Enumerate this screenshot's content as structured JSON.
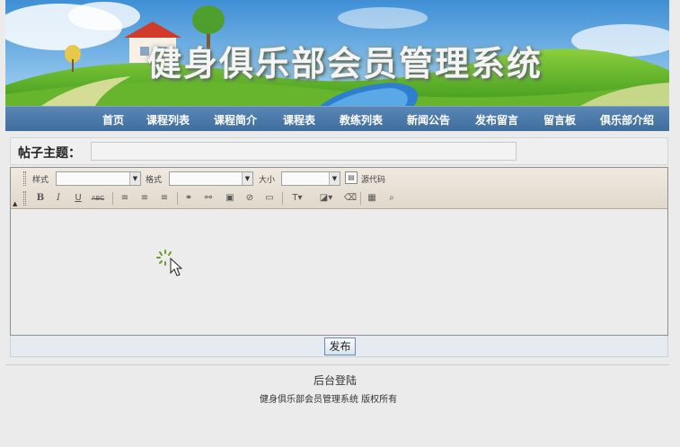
{
  "banner": {
    "title": "健身俱乐部会员管理系统"
  },
  "nav": {
    "items": [
      "首页",
      "课程列表",
      "课程简介",
      "课程表",
      "教练列表",
      "新闻公告",
      "发布留言",
      "留言板",
      "俱乐部介绍"
    ]
  },
  "form": {
    "subject_label": "帖子主题：",
    "subject_value": ""
  },
  "editor": {
    "style_label": "样式",
    "format_label": "格式",
    "size_label": "大小",
    "source_label": "源代码",
    "bold": "B",
    "italic": "I",
    "underline": "U",
    "strike": "ABC"
  },
  "submit": {
    "label": "发布"
  },
  "footer": {
    "admin_link": "后台登陆",
    "copyright": "健身俱乐部会员管理系统  版权所有"
  }
}
